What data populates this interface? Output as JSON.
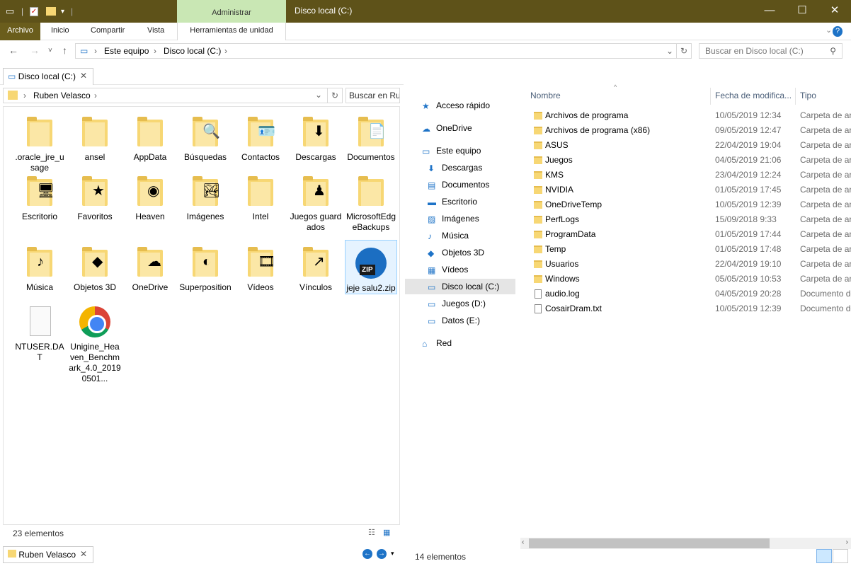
{
  "window": {
    "title": "Disco local (C:)",
    "context_tab": "Administrar",
    "controls": {
      "minimize": "—",
      "maximize": "☐",
      "close": "✕"
    }
  },
  "ribbon": {
    "tabs": [
      "Archivo",
      "Inicio",
      "Compartir",
      "Vista",
      "Herramientas de unidad"
    ],
    "expand_glyph": "⌄",
    "help_glyph": "?"
  },
  "address": {
    "crumbs": [
      "Este equipo",
      "Disco local (C:)"
    ],
    "search_placeholder": "Buscar en Disco local (C:)"
  },
  "left_pane": {
    "tab_label": "Disco local (C:)",
    "path_crumb": "Ruben Velasco",
    "search_text": "Buscar en Rul",
    "items": [
      {
        "label": ".oracle_jre_usage",
        "kind": "folder",
        "overlay": ""
      },
      {
        "label": "ansel",
        "kind": "folder",
        "overlay": ""
      },
      {
        "label": "AppData",
        "kind": "folder",
        "overlay": ""
      },
      {
        "label": "Búsquedas",
        "kind": "folder",
        "overlay": "🔍"
      },
      {
        "label": "Contactos",
        "kind": "folder",
        "overlay": "🪪"
      },
      {
        "label": "Descargas",
        "kind": "folder",
        "overlay": "⬇"
      },
      {
        "label": "Documentos",
        "kind": "folder",
        "overlay": "📄"
      },
      {
        "label": "Escritorio",
        "kind": "folder",
        "overlay": "🖥"
      },
      {
        "label": "Favoritos",
        "kind": "folder",
        "overlay": "★"
      },
      {
        "label": "Heaven",
        "kind": "folder",
        "overlay": "◉"
      },
      {
        "label": "Imágenes",
        "kind": "folder",
        "overlay": "🏞"
      },
      {
        "label": "Intel",
        "kind": "folder",
        "overlay": ""
      },
      {
        "label": "Juegos guardados",
        "kind": "folder",
        "overlay": "♟"
      },
      {
        "label": "MicrosoftEdgeBackups",
        "kind": "folder",
        "overlay": ""
      },
      {
        "label": "Música",
        "kind": "folder",
        "overlay": "♪"
      },
      {
        "label": "Objetos 3D",
        "kind": "folder",
        "overlay": "◆"
      },
      {
        "label": "OneDrive",
        "kind": "folder",
        "overlay": "☁"
      },
      {
        "label": "Superposition",
        "kind": "folder",
        "overlay": "◐"
      },
      {
        "label": "Vídeos",
        "kind": "folder",
        "overlay": "🎞"
      },
      {
        "label": "Vínculos",
        "kind": "folder",
        "overlay": "↗"
      },
      {
        "label": "jeje salu2.zip",
        "kind": "zip",
        "overlay": "ZIP"
      },
      {
        "label": "NTUSER.DAT",
        "kind": "file",
        "overlay": ""
      },
      {
        "label": "Unigine_Heaven_Benchmark_4.0_20190501...",
        "kind": "chrome",
        "overlay": ""
      }
    ],
    "status": "23 elementos",
    "bottom_tab": "Ruben Velasco"
  },
  "nav_pane": {
    "items": [
      {
        "label": "Acceso rápido",
        "icon": "star-icon"
      },
      {
        "label": "OneDrive",
        "icon": "cloud-icon"
      },
      {
        "label": "Este equipo",
        "icon": "computer-icon"
      },
      {
        "label": "Descargas",
        "icon": "download-icon"
      },
      {
        "label": "Documentos",
        "icon": "document-icon"
      },
      {
        "label": "Escritorio",
        "icon": "desktop-icon"
      },
      {
        "label": "Imágenes",
        "icon": "image-icon"
      },
      {
        "label": "Música",
        "icon": "music-icon"
      },
      {
        "label": "Objetos 3D",
        "icon": "cube-icon"
      },
      {
        "label": "Vídeos",
        "icon": "video-icon"
      },
      {
        "label": "Disco local (C:)",
        "icon": "drive-icon"
      },
      {
        "label": "Juegos (D:)",
        "icon": "drive-icon"
      },
      {
        "label": "Datos (E:)",
        "icon": "drive-icon"
      },
      {
        "label": "Red",
        "icon": "network-icon"
      }
    ]
  },
  "file_list": {
    "columns": [
      "Nombre",
      "Fecha de modifica...",
      "Tipo"
    ],
    "rows": [
      {
        "name": "Archivos de programa",
        "date": "10/05/2019 12:34",
        "type": "Carpeta de archivos",
        "kind": "folder"
      },
      {
        "name": "Archivos de programa (x86)",
        "date": "09/05/2019 12:47",
        "type": "Carpeta de archivos",
        "kind": "folder"
      },
      {
        "name": "ASUS",
        "date": "22/04/2019 19:04",
        "type": "Carpeta de archivos",
        "kind": "folder"
      },
      {
        "name": "Juegos",
        "date": "04/05/2019 21:06",
        "type": "Carpeta de archivos",
        "kind": "folder"
      },
      {
        "name": "KMS",
        "date": "23/04/2019 12:24",
        "type": "Carpeta de archivos",
        "kind": "folder"
      },
      {
        "name": "NVIDIA",
        "date": "01/05/2019 17:45",
        "type": "Carpeta de archivos",
        "kind": "folder"
      },
      {
        "name": "OneDriveTemp",
        "date": "10/05/2019 12:39",
        "type": "Carpeta de archivos",
        "kind": "folder"
      },
      {
        "name": "PerfLogs",
        "date": "15/09/2018 9:33",
        "type": "Carpeta de archivos",
        "kind": "folder"
      },
      {
        "name": "ProgramData",
        "date": "01/05/2019 17:44",
        "type": "Carpeta de archivos",
        "kind": "folder"
      },
      {
        "name": "Temp",
        "date": "01/05/2019 17:48",
        "type": "Carpeta de archivos",
        "kind": "folder"
      },
      {
        "name": "Usuarios",
        "date": "22/04/2019 19:10",
        "type": "Carpeta de archivos",
        "kind": "folder"
      },
      {
        "name": "Windows",
        "date": "05/05/2019 10:53",
        "type": "Carpeta de archivos",
        "kind": "folder"
      },
      {
        "name": "audio.log",
        "date": "04/05/2019 20:28",
        "type": "Documento de texto",
        "kind": "file"
      },
      {
        "name": "CosairDram.txt",
        "date": "10/05/2019 12:39",
        "type": "Documento de texto",
        "kind": "file"
      }
    ],
    "status": "14 elementos"
  },
  "colors": {
    "titlebar": "#5e5219",
    "context_tab": "#c9e7b4",
    "folder": "#f7d774",
    "selection": "#e5f3ff"
  }
}
